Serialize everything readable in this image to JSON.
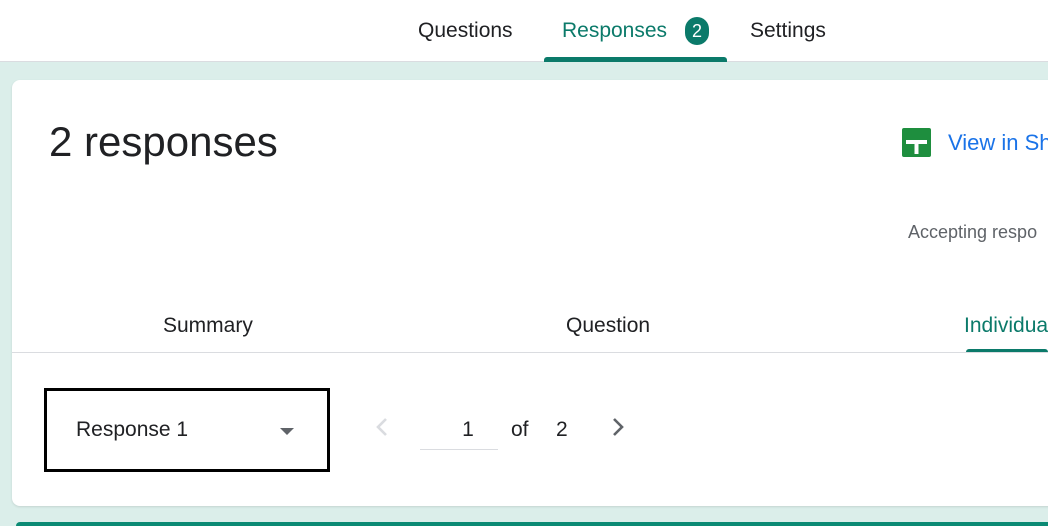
{
  "top_tabs": {
    "questions": "Questions",
    "responses": "Responses",
    "responses_badge": "2",
    "settings": "Settings"
  },
  "header": {
    "title": "2 responses",
    "view_in_sheets": "View in Sh",
    "accepting": "Accepting respo"
  },
  "sub_tabs": {
    "summary": "Summary",
    "question": "Question",
    "individual": "Individua"
  },
  "individual": {
    "selected_response": "Response 1",
    "page_current": "1",
    "of_label": "of",
    "page_total": "2"
  },
  "icons": {
    "sheets": "google-sheets-icon",
    "dropdown": "caret-down-icon",
    "prev": "chevron-left-icon",
    "next": "chevron-right-icon"
  },
  "colors": {
    "accent": "#0b7a6a",
    "link": "#1a73e8",
    "canvas": "#dbeeea",
    "sheets_green": "#1e8e3e"
  }
}
